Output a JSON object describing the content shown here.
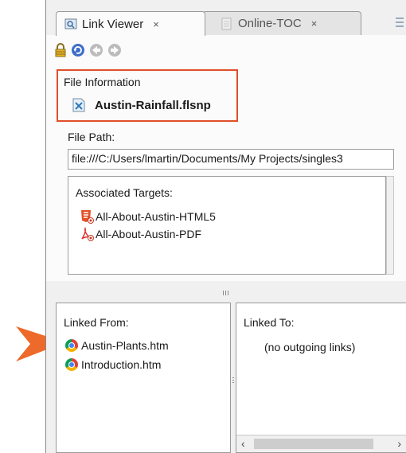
{
  "tabs": [
    {
      "label": "Link Viewer",
      "close": "×",
      "active": true
    },
    {
      "label": "Online-TOC",
      "close": "×",
      "active": false
    }
  ],
  "toolbar": {
    "icons": [
      "lock-icon",
      "refresh-icon",
      "back-icon",
      "forward-icon"
    ]
  },
  "file_info": {
    "heading": "File Information",
    "file_name": "Austin-Rainfall.flsnp"
  },
  "file_path": {
    "label": "File Path:",
    "value": "file:///C:/Users/lmartin/Documents/My Projects/singles3"
  },
  "targets": {
    "label": "Associated Targets:",
    "items": [
      {
        "label": "All-About-Austin-HTML5",
        "icon": "html5-target-icon"
      },
      {
        "label": "All-About-Austin-PDF",
        "icon": "pdf-target-icon"
      }
    ]
  },
  "linked_from": {
    "label": "Linked From:",
    "items": [
      "Austin-Plants.htm",
      "Introduction.htm"
    ]
  },
  "linked_to": {
    "label": "Linked To:",
    "empty_text": "(no outgoing links)"
  },
  "colors": {
    "callout_border": "#e04f2a",
    "arrow": "#ee6a2a"
  }
}
